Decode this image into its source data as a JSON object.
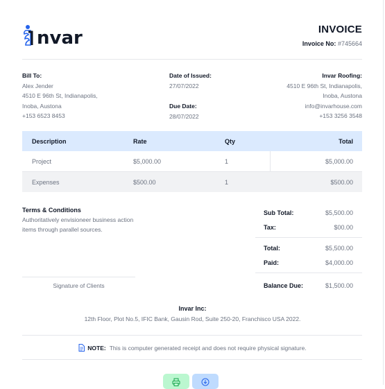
{
  "brand": {
    "logo_text": "nvar",
    "accent": "#2563eb"
  },
  "invoice": {
    "title": "INVOICE",
    "number_label": "Invoice No:",
    "number_value": "#745664"
  },
  "bill_to": {
    "heading": "Bill To:",
    "name": "Alex Jender",
    "address_line1": "4510 E 96th St, Indianapolis,",
    "address_line2": "Inoba, Austona",
    "phone": "+153 6523 8453"
  },
  "dates": {
    "issued_label": "Date of Issued:",
    "issued_value": "27/07/2022",
    "due_label": "Due Date:",
    "due_value": "28/07/2022"
  },
  "seller": {
    "heading": "Invar Roofing:",
    "address_line1": "4510 E 96th St, Indianapolis,",
    "address_line2": "Inoba, Austona",
    "email": "info@invarhouse.com",
    "phone": "+153 3256 3548"
  },
  "table": {
    "headers": [
      "Description",
      "Rate",
      "Qty",
      "Total"
    ],
    "rows": [
      {
        "description": "Project",
        "rate": "$5,000.00",
        "qty": "1",
        "total": "$5,000.00"
      },
      {
        "description": "Expenses",
        "rate": "$500.00",
        "qty": "1",
        "total": "$500.00"
      }
    ]
  },
  "terms": {
    "heading": "Terms & Conditions",
    "body": "Authoritatively envisioneer business action items through parallel sources."
  },
  "signature": {
    "label": "Signature of Clients"
  },
  "totals": {
    "subtotal_label": "Sub Total:",
    "subtotal_value": "$5,500.00",
    "tax_label": "Tax:",
    "tax_value": "$00.00",
    "total_label": "Total:",
    "total_value": "$5,500.00",
    "paid_label": "Paid:",
    "paid_value": "$4,000.00",
    "balance_label": "Balance Due:",
    "balance_value": "$1,500.00"
  },
  "footer": {
    "company": "Invar Inc:",
    "address": "12th Floor, Plot No.5, IFIC Bank, Gausin Rod, Suite 250-20, Franchisco USA 2022.",
    "note_label": "NOTE:",
    "note_text": "This is computer generated receipt and does not require physical signature."
  },
  "actions": {
    "print_icon": "printer-icon",
    "download_icon": "download-icon"
  }
}
